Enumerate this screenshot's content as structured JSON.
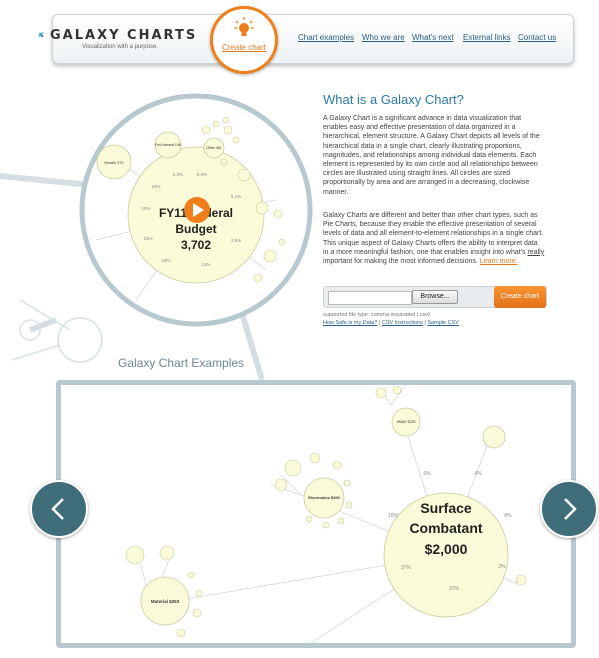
{
  "header": {
    "logo_text": "GALAXY CHARTS",
    "tagline": "Visualization with a purpose.",
    "create_chart_label": "Create chart",
    "nav": [
      "Chart examples",
      "Who we are",
      "What's next",
      "External links",
      "Contact us"
    ]
  },
  "hero_chart": {
    "center_line1": "FY11 Federal",
    "center_line2": "Budget",
    "center_value": "3,702",
    "bubble_labels": [
      "Health 372",
      "Fed Interest 196",
      "Other 481"
    ],
    "percent_labels": [
      "10%",
      "15%",
      "16%",
      "18%",
      "13%",
      "6.3%",
      "8.5%",
      "5.1%",
      "2.5%",
      "10%"
    ]
  },
  "intro": {
    "title": "What is a Galaxy Chart?",
    "para1": "A Galaxy Chart is a significant advance in data visualization that enables easy and effective presentation of data organized in a hierarchical, element structure. A Galaxy Chart depicts all levels of the hierarchical data in a single chart, clearly illustrating proportions, magnitudes, and relationships among individual data elements. Each element is represented by its own circle and all relationships between circles are illustrated using straight lines. All circles are sized proportionally by area and are arranged in a decreasing, clockwise manner.",
    "para2_a": "Galaxy Charts are different and better than other chart types, such as Pie Charts, because they enable the effective presentation of several levels of data and all element-to-element relationships in a single chart. This unique aspect of Galaxy Charts offers the ability to interpret data in a more meaningful fashion, one that enables insight into what's ",
    "para2_really": "really",
    "para2_b": " important for making the most informed decisions. ",
    "learn_more": "Learn more."
  },
  "upload": {
    "browse_label": "Browse...",
    "create_label": "Create chart",
    "file_type_note": "supported file type: comma separated (.csv)",
    "link1": "How Safe is my Data?",
    "link2": "CSV Instructions",
    "link3": "Sample CSV",
    "sep": " | "
  },
  "examples": {
    "title": "Galaxy Chart Examples",
    "center_line1": "Surface",
    "center_line2": "Combatant",
    "center_value": "$2,000",
    "electronics": "Electronics $200",
    "material": "Material $253",
    "hmwe": "HM&E $225",
    "percent_labels": [
      "6%",
      "4%",
      "10%",
      "8%",
      "37%",
      "37%",
      "2%"
    ],
    "prev_icon": "chevron-left-icon",
    "next_icon": "chevron-right-icon"
  },
  "colors": {
    "accent_orange": "#f07f1b",
    "link_blue": "#2b5f86",
    "title_blue": "#2c79a8",
    "bubble_fill": "#fbfbd9",
    "ring": "#b7c8cf",
    "arrow": "#3f6d79"
  }
}
